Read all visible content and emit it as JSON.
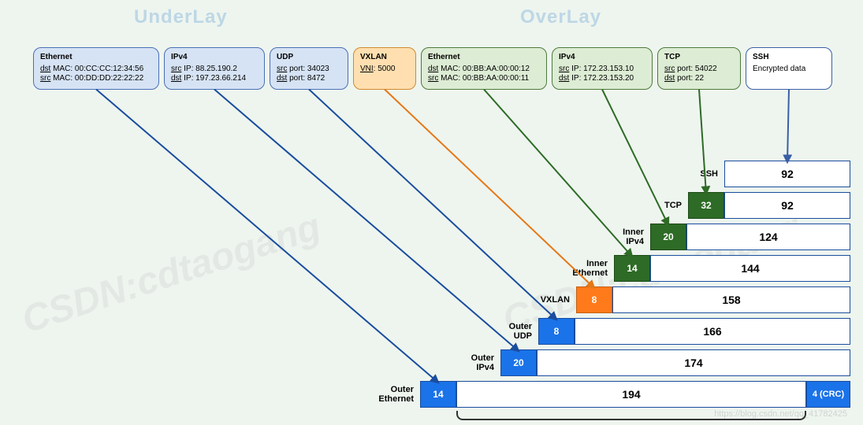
{
  "sections": {
    "underlay": "UnderLay",
    "overlay": "OverLay"
  },
  "watermark": "CSDN:cdtaogang",
  "footer_watermark": "https://blog.csdn.net/qq_41782425",
  "headers": [
    {
      "id": "outer_eth",
      "title": "Ethernet",
      "lines": [
        "dst MAC: 00:CC:CC:12:34:56",
        "src MAC: 00:DD:DD:22:22:22"
      ],
      "color": "blue"
    },
    {
      "id": "outer_ipv4",
      "title": "IPv4",
      "lines": [
        "src IP: 88.25.190.2",
        "dst IP: 197.23.66.214"
      ],
      "color": "blue"
    },
    {
      "id": "outer_udp",
      "title": "UDP",
      "lines": [
        "src port: 34023",
        "dst port: 8472"
      ],
      "color": "blue"
    },
    {
      "id": "vxlan",
      "title": "VXLAN",
      "lines": [
        "VNI: 5000"
      ],
      "color": "orange"
    },
    {
      "id": "inner_eth",
      "title": "Ethernet",
      "lines": [
        "dst MAC: 00:BB:AA:00:00:12",
        "src MAC: 00:BB:AA:00:00:11"
      ],
      "color": "green"
    },
    {
      "id": "inner_ipv4",
      "title": "IPv4",
      "lines": [
        "src IP: 172.23.153.10",
        "dst IP: 172.23.153.20"
      ],
      "color": "green"
    },
    {
      "id": "tcp",
      "title": "TCP",
      "lines": [
        "src port: 54022",
        "dst port: 22"
      ],
      "color": "green"
    },
    {
      "id": "ssh",
      "title": "SSH",
      "lines": [
        "Encrypted data"
      ],
      "color": "white"
    }
  ],
  "stack_rows": [
    {
      "label": "SSH",
      "header_size": null,
      "header_color": null,
      "payload": "92",
      "payload_w": 160,
      "crc": null
    },
    {
      "label": "TCP",
      "header_size": "32",
      "header_color": "dgreen",
      "payload": "92",
      "payload_w": 160,
      "crc": null
    },
    {
      "label": "Inner\nIPv4",
      "header_size": "20",
      "header_color": "dgreen",
      "payload": "124",
      "payload_w": 208,
      "crc": null
    },
    {
      "label": "Inner\nEthernet",
      "header_size": "14",
      "header_color": "dgreen",
      "payload": "144",
      "payload_w": 254,
      "crc": null
    },
    {
      "label": "VXLAN",
      "header_size": "8",
      "header_color": "orange",
      "payload": "158",
      "payload_w": 302,
      "crc": null
    },
    {
      "label": "Outer\nUDP",
      "header_size": "8",
      "header_color": "blue",
      "payload": "166",
      "payload_w": 350,
      "crc": null
    },
    {
      "label": "Outer\nIPv4",
      "header_size": "20",
      "header_color": "blue",
      "payload": "174",
      "payload_w": 398,
      "crc": null
    },
    {
      "label": "Outer\nEthernet",
      "header_size": "14",
      "header_color": "blue",
      "payload": "194",
      "payload_w": 444,
      "crc": "4 (CRC)"
    }
  ],
  "arrow_defs": [
    {
      "from": "outer_eth",
      "to_row": 7,
      "color": "#1a4d9e"
    },
    {
      "from": "outer_ipv4",
      "to_row": 6,
      "color": "#1a4d9e"
    },
    {
      "from": "outer_udp",
      "to_row": 5,
      "color": "#1a4d9e"
    },
    {
      "from": "vxlan",
      "to_row": 4,
      "color": "#e57817"
    },
    {
      "from": "inner_eth",
      "to_row": 3,
      "color": "#2e6b26"
    },
    {
      "from": "inner_ipv4",
      "to_row": 2,
      "color": "#2e6b26"
    },
    {
      "from": "tcp",
      "to_row": 1,
      "color": "#2e6b26"
    },
    {
      "from": "ssh",
      "to_row": 0,
      "color": "#3a5fa5"
    }
  ]
}
